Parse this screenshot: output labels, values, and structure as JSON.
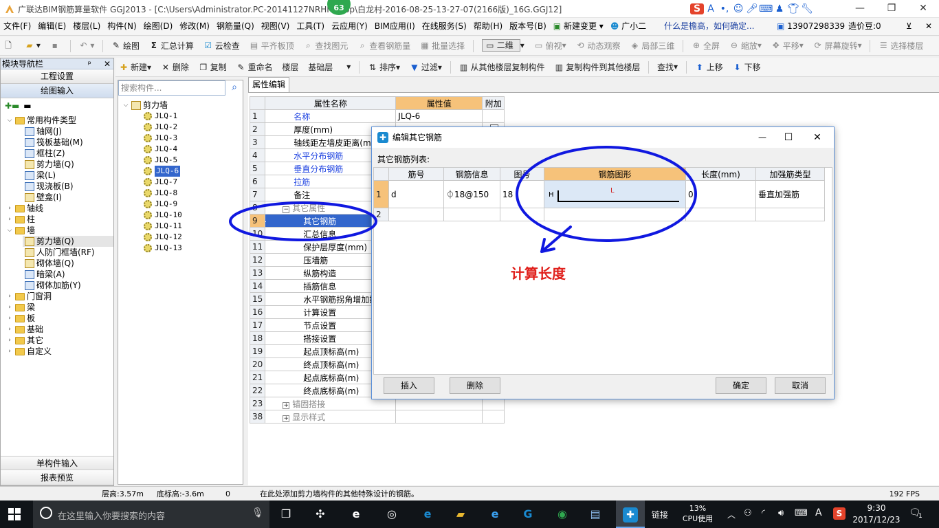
{
  "window": {
    "title": "广联达BIM钢筋算量软件 GGJ2013 - [C:\\Users\\Administrator.PC-20141127NRHM\\...op\\白龙村-2016-08-25-13-27-07(2166版)_16G.GGJ12]",
    "badge": "63"
  },
  "menu": [
    "文件(F)",
    "编辑(E)",
    "楼层(L)",
    "构件(N)",
    "绘图(D)",
    "修改(M)",
    "钢筋量(Q)",
    "视图(V)",
    "工具(T)",
    "云应用(Y)",
    "BIM应用(I)",
    "在线服务(S)",
    "帮助(H)",
    "版本号(B)",
    "新建变更",
    "广小二"
  ],
  "menu_right": {
    "question": "什么是檐高，如何确定...",
    "phone": "13907298339",
    "price": "造价豆:0"
  },
  "toolbar1": {
    "draw": "绘图",
    "sum": "汇总计算",
    "cloud_check": "云检查",
    "align_top": "平齐板顶",
    "find_element": "查找图元",
    "view_rebar": "查看钢筋量",
    "batch_select": "批量选择",
    "view_mode": "二维",
    "overlook": "俯视",
    "dynamic": "动态观察",
    "local3d": "局部三维",
    "fullscreen": "全屏",
    "zoom": "缩放",
    "pan": "平移",
    "rotate": "屏幕旋转",
    "select_floor": "选择楼层"
  },
  "toolbar2": {
    "new": "新建",
    "delete": "删除",
    "copy": "复制",
    "rename": "重命名",
    "floor_label": "楼层",
    "floor_value": "基础层",
    "sort": "排序",
    "filter": "过滤",
    "copy_from": "从其他楼层复制构件",
    "copy_to": "复制构件到其他楼层",
    "find": "查找",
    "up": "上移",
    "down": "下移"
  },
  "nav": {
    "header": "模块导航栏",
    "btn_project": "工程设置",
    "btn_draw": "绘图输入",
    "btn_single": "单构件输入",
    "btn_report": "报表预览",
    "tree_common": "常用构件类型",
    "common_items": [
      "轴网(J)",
      "筏板基础(M)",
      "框柱(Z)",
      "剪力墙(Q)",
      "梁(L)",
      "现浇板(B)",
      "壁龛(I)"
    ],
    "groups_before_wall": [
      "轴线",
      "柱"
    ],
    "wall": "墙",
    "wall_items": [
      "剪力墙(Q)",
      "人防门框墙(RF)",
      "砌体墙(Q)",
      "暗梁(A)",
      "砌体加筋(Y)"
    ],
    "groups_after_wall": [
      "门窗洞",
      "梁",
      "板",
      "基础",
      "其它",
      "自定义"
    ]
  },
  "complist": {
    "search_placeholder": "搜索构件...",
    "root": "剪力墙",
    "items": [
      "JLQ-1",
      "JLQ-2",
      "JLQ-3",
      "JLQ-4",
      "JLQ-5",
      "JLQ-6",
      "JLQ-7",
      "JLQ-8",
      "JLQ-9",
      "JLQ-10",
      "JLQ-11",
      "JLQ-12",
      "JLQ-13"
    ],
    "selected": "JLQ-6"
  },
  "props": {
    "tab": "属性编辑",
    "col_name": "属性名称",
    "col_value": "属性值",
    "col_extra": "附加",
    "rows": [
      {
        "n": "1",
        "name": "名称",
        "value": "JLQ-6"
      },
      {
        "n": "2",
        "name": "厚度(mm)",
        "value": ""
      },
      {
        "n": "3",
        "name": "轴线距左墙皮距离(mm)",
        "value": ""
      },
      {
        "n": "4",
        "name": "水平分布钢筋",
        "value": ""
      },
      {
        "n": "5",
        "name": "垂直分布钢筋",
        "value": ""
      },
      {
        "n": "6",
        "name": "拉筋",
        "value": ""
      },
      {
        "n": "7",
        "name": "备注",
        "value": ""
      },
      {
        "n": "8",
        "name": "其它属性",
        "value": ""
      },
      {
        "n": "9",
        "name": "其它钢筋",
        "value": ""
      },
      {
        "n": "10",
        "name": "汇总信息",
        "value": ""
      },
      {
        "n": "11",
        "name": "保护层厚度(mm)",
        "value": ""
      },
      {
        "n": "12",
        "name": "压墙筋",
        "value": ""
      },
      {
        "n": "13",
        "name": "纵筋构造",
        "value": ""
      },
      {
        "n": "14",
        "name": "插筋信息",
        "value": ""
      },
      {
        "n": "15",
        "name": "水平钢筋拐角增加搭接",
        "value": ""
      },
      {
        "n": "16",
        "name": "计算设置",
        "value": ""
      },
      {
        "n": "17",
        "name": "节点设置",
        "value": ""
      },
      {
        "n": "18",
        "name": "搭接设置",
        "value": ""
      },
      {
        "n": "19",
        "name": "起点顶标高(m)",
        "value": ""
      },
      {
        "n": "20",
        "name": "终点顶标高(m)",
        "value": ""
      },
      {
        "n": "21",
        "name": "起点底标高(m)",
        "value": ""
      },
      {
        "n": "22",
        "name": "终点底标高(m)",
        "value": ""
      },
      {
        "n": "23",
        "name": "锚固搭接",
        "value": ""
      },
      {
        "n": "38",
        "name": "显示样式",
        "value": ""
      }
    ]
  },
  "dialog": {
    "title": "编辑其它钢筋",
    "list_label": "其它钢筋列表:",
    "cols": [
      "筋号",
      "钢筋信息",
      "图号",
      "钢筋图形",
      "长度(mm)",
      "加强筋类型"
    ],
    "row1": {
      "n": "1",
      "id": "d",
      "info": "⏀18@150",
      "fig": "18",
      "shape_h": "H",
      "shape_l": "L",
      "length": "0",
      "type": "垂直加强筋"
    },
    "row2": {
      "n": "2"
    },
    "btn_insert": "插入",
    "btn_delete": "删除",
    "btn_ok": "确定",
    "btn_cancel": "取消"
  },
  "annotation": "计算长度",
  "status": {
    "floor_height": "层高:3.57m",
    "bottom": "底标高:-3.6m",
    "zero": "0",
    "hint": "在此处添加剪力墙构件的其他特殊设计的钢筋。",
    "fps": "192 FPS"
  },
  "taskbar": {
    "search_placeholder": "在这里输入你要搜索的内容",
    "link": "链接",
    "cpu_pct": "13%",
    "cpu_label": "CPU使用",
    "ime": "A",
    "time": "9:30",
    "date": "2017/12/23",
    "notif": "1"
  }
}
